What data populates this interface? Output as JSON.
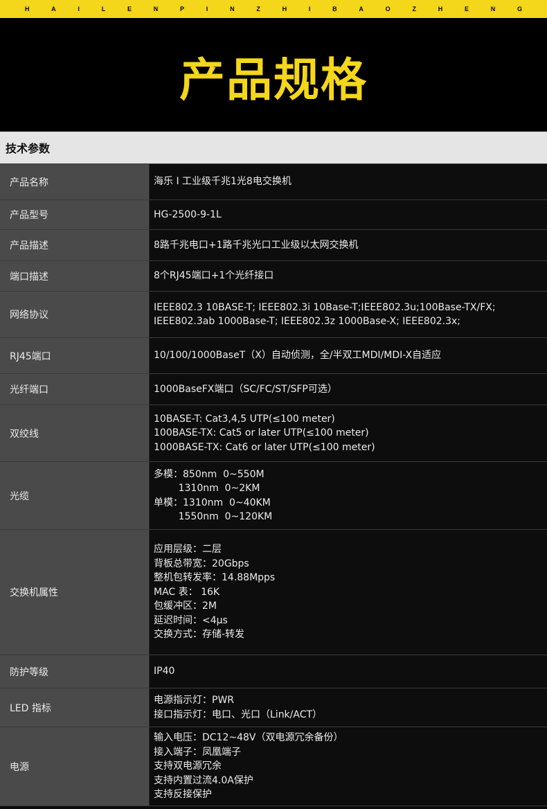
{
  "top_letters": [
    "H",
    "A",
    "I",
    "L",
    "E",
    "N",
    "P",
    "I",
    "N",
    "Z",
    "H",
    "I",
    "B",
    "A",
    "O",
    "Z",
    "H",
    "E",
    "N",
    "G"
  ],
  "banner_title": "产品规格",
  "section_title": "技术参数",
  "rows": [
    {
      "label": "产品名称",
      "lines": [
        "海乐 I 工业级千兆1光8电交换机"
      ]
    },
    {
      "label": "产品型号",
      "lines": [
        "HG-2500-9-1L"
      ]
    },
    {
      "label": "产品描述",
      "lines": [
        "8路千兆电口+1路千兆光口工业级以太网交换机"
      ]
    },
    {
      "label": "端口描述",
      "lines": [
        "8个RJ45端口+1个光纤接口"
      ]
    },
    {
      "label": "网络协议",
      "lines": [
        "IEEE802.3 10BASE-T; IEEE802.3i 10Base-T;IEEE802.3u;100Base-TX/FX;",
        "IEEE802.3ab 1000Base-T; IEEE802.3z 1000Base-X; IEEE802.3x;"
      ]
    },
    {
      "label": "RJ45端口",
      "lines": [
        "10/100/1000BaseT（X）自动侦测，全/半双工MDI/MDI-X自适应"
      ]
    },
    {
      "label": "光纤端口",
      "lines": [
        "1000BaseFX端口（SC/FC/ST/SFP可选）"
      ]
    },
    {
      "label": "双绞线",
      "lines": [
        "10BASE-T: Cat3,4,5 UTP(≤100 meter)",
        "100BASE-TX: Cat5 or later UTP(≤100 meter)",
        "1000BASE-TX: Cat6 or later UTP(≤100 meter)"
      ]
    },
    {
      "label": "光缆",
      "lines": [
        "多模：850nm  0~550M",
        "        1310nm  0~2KM",
        "单模：1310nm  0~40KM",
        "        1550nm  0~120KM"
      ]
    },
    {
      "label": "交换机属性",
      "lines": [
        "应用层级：二层",
        "背板总带宽：20Gbps",
        "整机包转发率：14.88Mpps",
        "MAC 表： 16K",
        "包缓冲区：2M",
        "延迟时间：<4μs",
        "交换方式：存储-转发"
      ]
    },
    {
      "label": "防护等级",
      "lines": [
        "IP40"
      ]
    },
    {
      "label": "LED 指标",
      "lines": [
        "电源指示灯：PWR",
        "接口指示灯：电口、光口（Link/ACT）"
      ]
    },
    {
      "label": "电源",
      "lines": [
        "输入电压：DC12~48V（双电源冗余备份）",
        "接入端子：凤凰端子",
        "支持双电源冗余",
        "支持内置过流4.0A保护",
        "支持反接保护"
      ]
    }
  ]
}
